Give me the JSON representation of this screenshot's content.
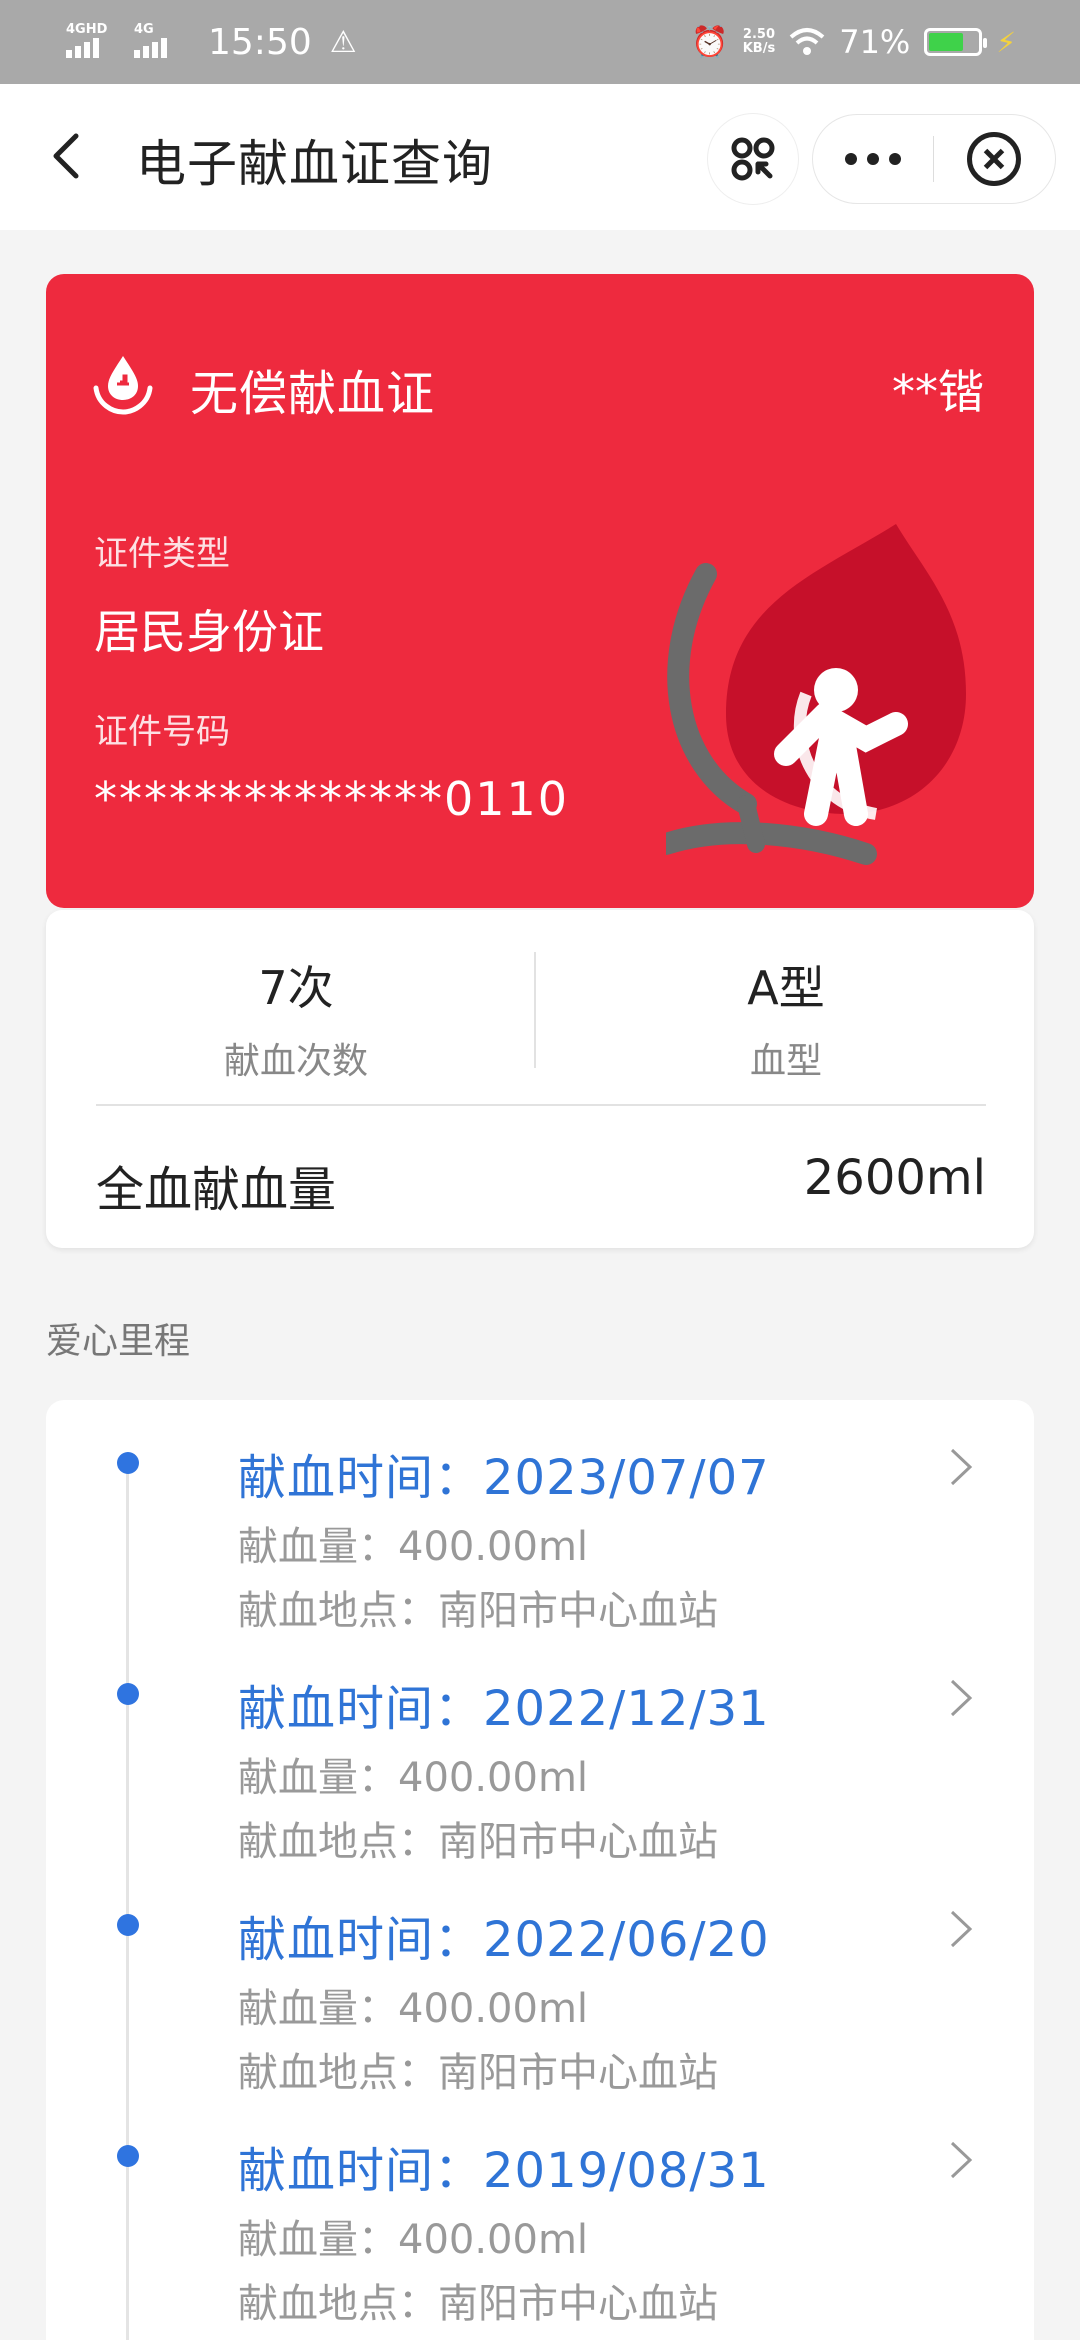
{
  "status_bar": {
    "signal1_label": "4GHD",
    "signal2_label": "4G",
    "time": "15:50",
    "speed_value": "2.50",
    "speed_unit": "KB/s",
    "battery": "71%",
    "battery_level": 0.71
  },
  "nav": {
    "title": "电子献血证查询"
  },
  "card": {
    "title": "无偿献血证",
    "holder_name": "**锴",
    "id_type_label": "证件类型",
    "id_type_value": "居民身份证",
    "id_number_label": "证件号码",
    "id_number_value": "**************0110"
  },
  "stats": {
    "count_value": "7次",
    "count_label": "献血次数",
    "type_value": "A型",
    "type_label": "血型",
    "total_label": "全血献血量",
    "total_value": "2600ml"
  },
  "section": {
    "title": "爱心里程"
  },
  "records": [
    {
      "time": "献血时间：2023/07/07",
      "amount": "献血量：400.00ml",
      "place": "献血地点：南阳市中心血站"
    },
    {
      "time": "献血时间：2022/12/31",
      "amount": "献血量：400.00ml",
      "place": "献血地点：南阳市中心血站"
    },
    {
      "time": "献血时间：2022/06/20",
      "amount": "献血量：400.00ml",
      "place": "献血地点：南阳市中心血站"
    },
    {
      "time": "献血时间：2019/08/31",
      "amount": "献血量：400.00ml",
      "place": "献血地点：南阳市中心血站"
    }
  ],
  "colors": {
    "card_red": "#ee2a3e",
    "link_blue": "#2f74d6",
    "status_bar_gray": "#a9a9a9"
  },
  "icons": [
    "back-icon",
    "scan-icon",
    "more-icon",
    "close-icon",
    "blood-drop-hands-icon",
    "chevron-right-icon"
  ]
}
